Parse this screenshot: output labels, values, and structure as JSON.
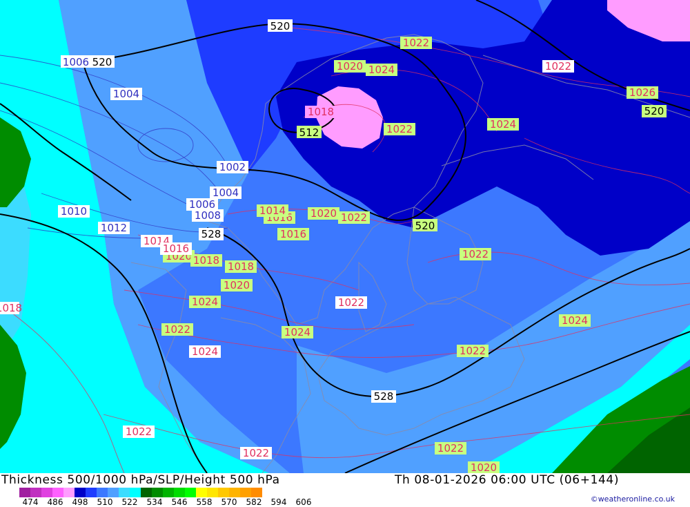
{
  "title": "Thickness 500/1000 hPa/SLP/Height 500 hPa",
  "datetime": "Th 08-01-2026 06:00 UTC (06+144)",
  "credit": "©weatheronline.co.uk",
  "legend": {
    "colors": [
      "#a020a0",
      "#c030c0",
      "#e040e0",
      "#ff60ff",
      "#ff9cff",
      "#0000c8",
      "#1e3cff",
      "#3c78ff",
      "#50a0ff",
      "#3cdcff",
      "#00ffff",
      "#006400",
      "#008c00",
      "#00b400",
      "#00dc00",
      "#00ff00",
      "#ffff00",
      "#ffe600",
      "#ffc800",
      "#ffb400",
      "#ffa000",
      "#ff8c00"
    ],
    "labels": [
      "474",
      "486",
      "498",
      "510",
      "522",
      "534",
      "546",
      "558",
      "570",
      "582",
      "594",
      "606"
    ]
  },
  "contour_labels": {
    "height500": [
      "520",
      "520",
      "520",
      "512",
      "528",
      "528",
      "520"
    ],
    "slp_red": [
      "1022",
      "1020",
      "1024",
      "1022",
      "1026",
      "1018",
      "1022",
      "1024",
      "1020",
      "1022",
      "1016",
      "1014",
      "1016",
      "1020",
      "1018",
      "1018",
      "1020",
      "1022",
      "1024",
      "1022",
      "1022",
      "1024",
      "1022",
      "1024",
      "1022",
      "1024",
      "1022",
      "1022",
      "1020",
      "1014",
      "1016",
      "1018",
      "1018"
    ],
    "slp_blue": [
      "1006",
      "1004",
      "1002",
      "1004",
      "1006",
      "1008",
      "1010",
      "1012"
    ]
  }
}
